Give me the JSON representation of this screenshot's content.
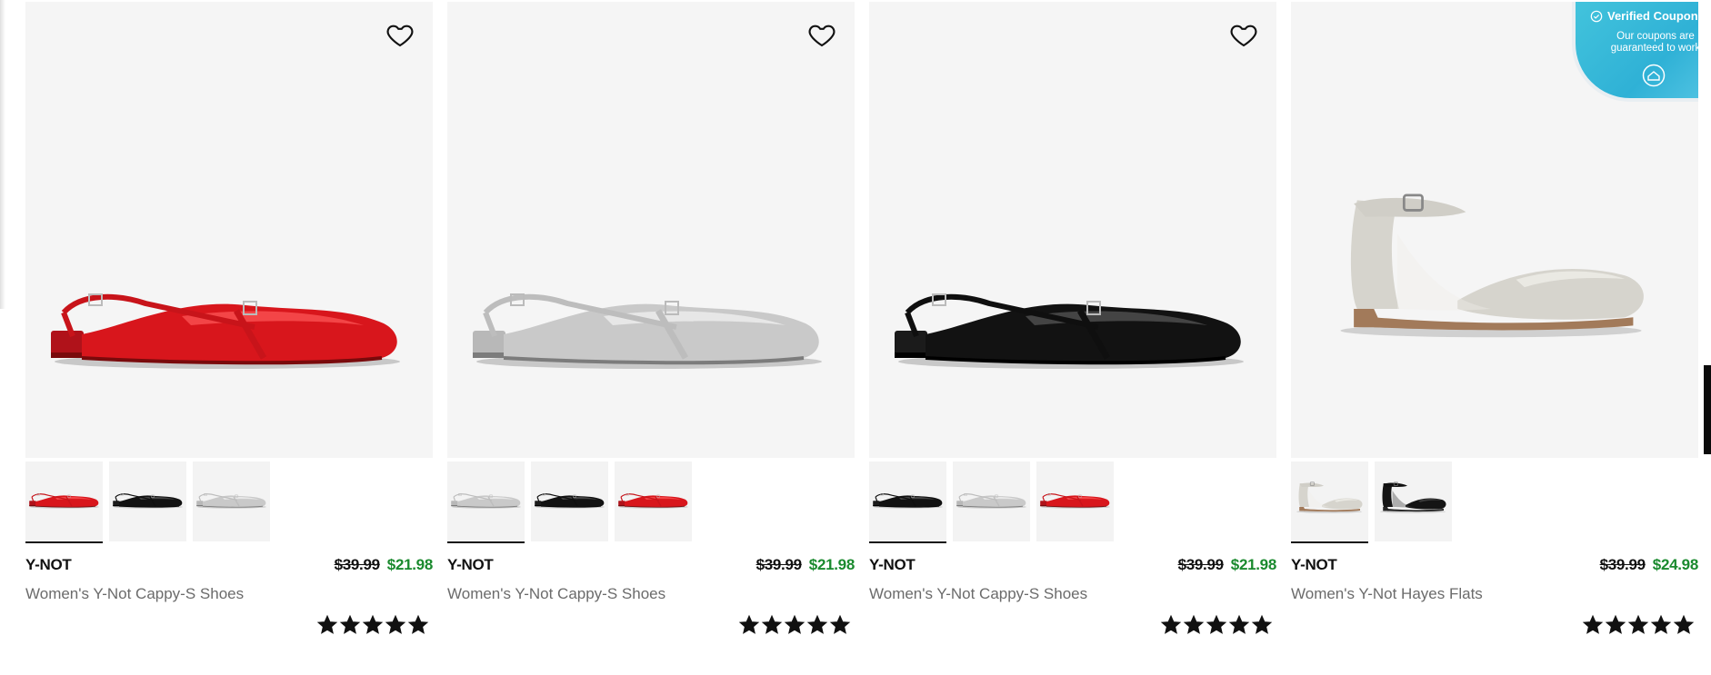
{
  "products": [
    {
      "brand": "Y-NOT",
      "old_price": "$39.99",
      "sale_price": "$21.98",
      "title": "Women's Y-Not Cappy-S Shoes",
      "rating": 5,
      "hero_color": "red",
      "swatches": [
        "red",
        "black",
        "silver"
      ],
      "selected_swatch": 0
    },
    {
      "brand": "Y-NOT",
      "old_price": "$39.99",
      "sale_price": "$21.98",
      "title": "Women's Y-Not Cappy-S Shoes",
      "rating": 5,
      "hero_color": "silver",
      "swatches": [
        "silver",
        "black",
        "red"
      ],
      "selected_swatch": 0
    },
    {
      "brand": "Y-NOT",
      "old_price": "$39.99",
      "sale_price": "$21.98",
      "title": "Women's Y-Not Cappy-S Shoes",
      "rating": 5,
      "hero_color": "black",
      "swatches": [
        "black",
        "silver",
        "red"
      ],
      "selected_swatch": 0
    },
    {
      "brand": "Y-NOT",
      "old_price": "$39.99",
      "sale_price": "$24.98",
      "title": "Women's Y-Not Hayes Flats",
      "rating": 5,
      "hero_color": "silver-flat",
      "swatches": [
        "silver-flat",
        "black-flat"
      ],
      "selected_swatch": 0
    }
  ],
  "coupon": {
    "title": "Verified Coupon",
    "subtitle": "Our coupons are guaranteed to work",
    "icon": "check-circle-icon"
  },
  "colors": {
    "sale_green": "#1a8a2e",
    "hero_bg": "#f5f5f5",
    "coupon_blue": "#2fb1d6"
  }
}
